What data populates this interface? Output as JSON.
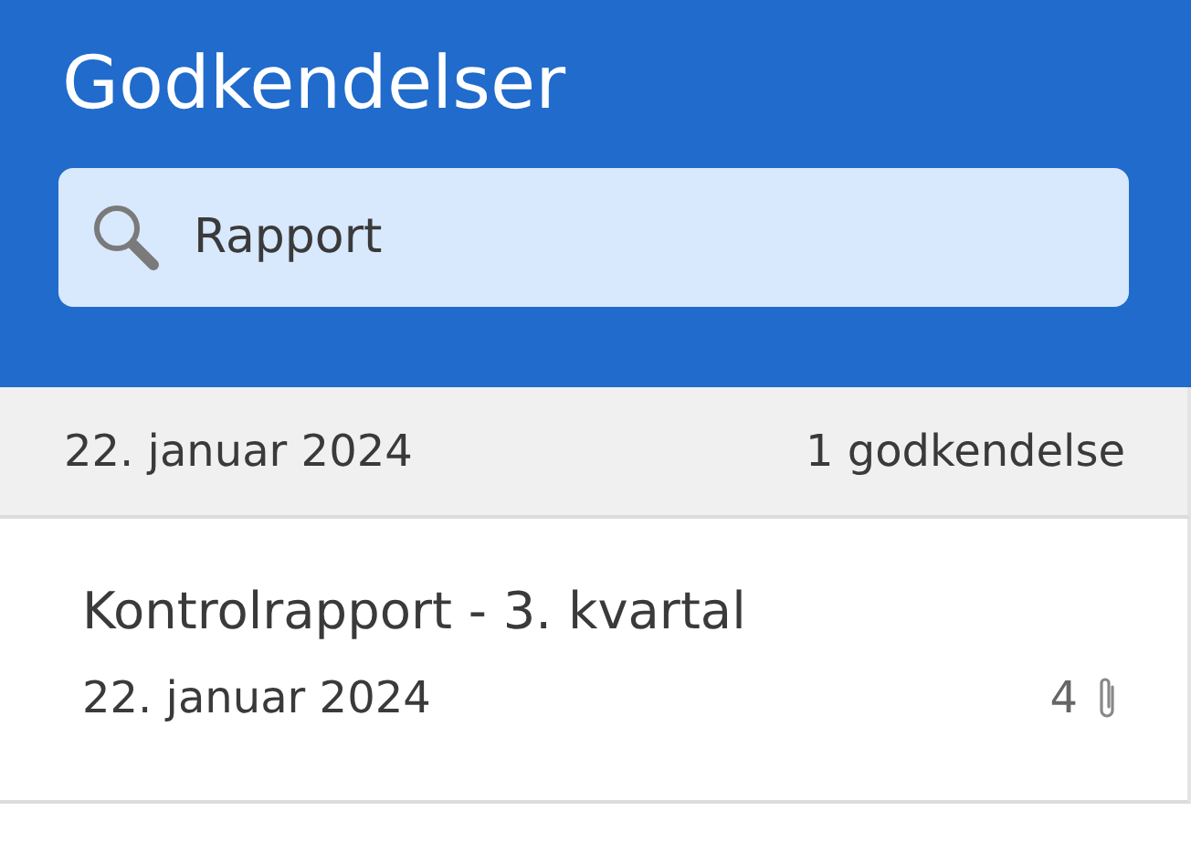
{
  "header": {
    "title": "Godkendelser"
  },
  "search": {
    "value": "Rapport"
  },
  "groups": [
    {
      "date": "22. januar 2024",
      "count": "1 godkendelse",
      "items": [
        {
          "title": "Kontrolrapport - 3. kvartal",
          "date": "22. januar 2024",
          "attachments": "4"
        }
      ]
    }
  ]
}
